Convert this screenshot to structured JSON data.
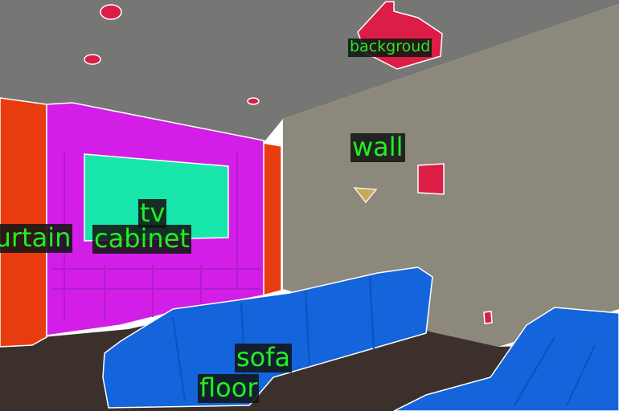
{
  "segments": [
    {
      "id": "background",
      "label": "backgroud",
      "color": "#dc1e46"
    },
    {
      "id": "wall",
      "label": "wall",
      "color": "#8c887c"
    },
    {
      "id": "tv",
      "label": "tv",
      "color": "#19e6aa"
    },
    {
      "id": "curtain",
      "label": "curtain",
      "color": "#e83c10"
    },
    {
      "id": "cabinet",
      "label": "cabinet",
      "color": "#d21ee6"
    },
    {
      "id": "sofa",
      "label": "sofa",
      "color": "#1464dc"
    },
    {
      "id": "floor",
      "label": "floor",
      "color": "#3c302c"
    }
  ],
  "colors": {
    "ceiling": "#767674",
    "wall": "#8c887c",
    "floor": "#3c302c",
    "outline": "#ffffff",
    "label_text": "#22ee22",
    "label_bg": "#121614"
  }
}
